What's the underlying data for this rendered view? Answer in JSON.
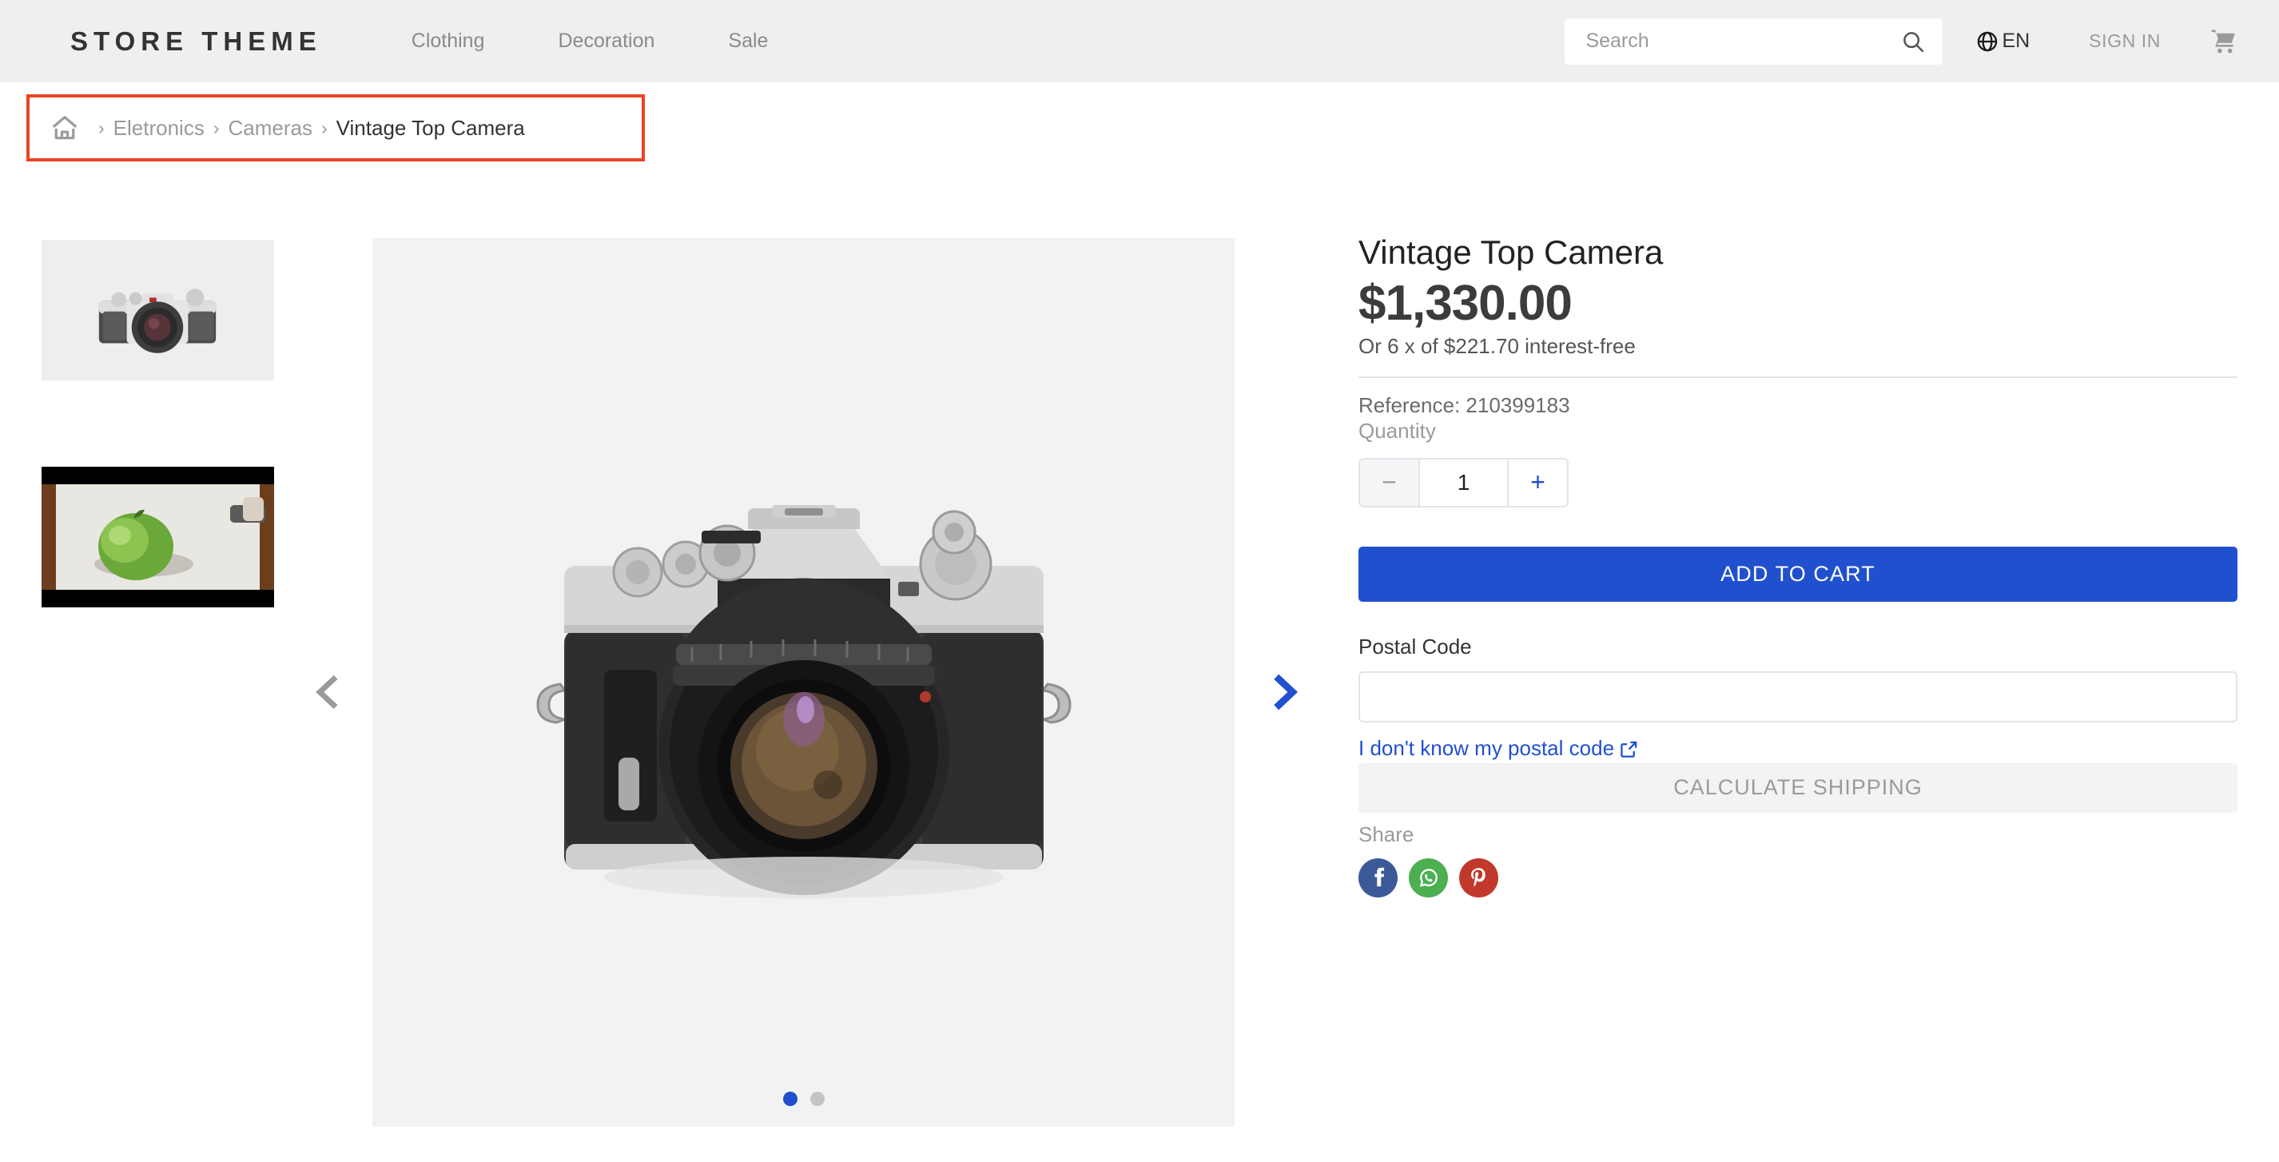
{
  "header": {
    "logo": "STORE THEME",
    "nav": [
      {
        "label": "Clothing"
      },
      {
        "label": "Decoration"
      },
      {
        "label": "Sale"
      }
    ],
    "search": {
      "placeholder": "Search",
      "value": "",
      "icon": "search-icon"
    },
    "language": {
      "label": "EN",
      "icon": "globe-icon"
    },
    "sign_in": "SIGN IN",
    "cart": {
      "icon": "cart-icon"
    },
    "background_color": "#efefef"
  },
  "breadcrumb": {
    "home_icon": "home-icon",
    "separator": "›",
    "items": [
      {
        "label": "Eletronics",
        "active": false
      },
      {
        "label": "Cameras",
        "active": false
      },
      {
        "label": "Vintage Top Camera",
        "active": true
      }
    ],
    "highlight_color": "#ea4325"
  },
  "gallery": {
    "thumbnails": [
      {
        "name": "vintage-slr-camera-front",
        "alt": "Silver and black vintage SLR camera on light gray background"
      },
      {
        "name": "green-apple-on-white-surface",
        "alt": "Green apple on a white surface with dark wood background"
      }
    ],
    "main_image": {
      "name": "vintage-slr-camera-front",
      "alt": "Silver and black vintage SLR camera centered on light gray background"
    },
    "prev_arrow": {
      "icon": "chevron-left-icon",
      "color": "#999999",
      "enabled": false
    },
    "next_arrow": {
      "icon": "chevron-right-icon",
      "color": "#2150cf",
      "enabled": true
    },
    "dots": [
      {
        "active": true
      },
      {
        "active": false
      }
    ],
    "active_index": 0,
    "background_color": "#f2f2f2"
  },
  "product": {
    "title": "Vintage Top Camera",
    "price": "$1,330.00",
    "installments": "Or 6 x of $221.70 interest-free",
    "reference": "Reference: 210399183",
    "quantity_label": "Quantity",
    "quantity": {
      "minus_label": "−",
      "value": "1",
      "plus_label": "+"
    },
    "add_to_cart": "ADD TO CART",
    "accent_color": "#2150cf"
  },
  "shipping": {
    "postal_label": "Postal Code",
    "postal_value": "",
    "postal_placeholder": "",
    "help_link": "I don't know my postal code",
    "help_link_icon": "external-link-icon",
    "calculate_button": "CALCULATE SHIPPING",
    "calculate_enabled": false
  },
  "share": {
    "label": "Share",
    "buttons": [
      {
        "name": "facebook",
        "color": "#3b5998"
      },
      {
        "name": "whatsapp",
        "color": "#4caf50"
      },
      {
        "name": "pinterest",
        "color": "#c0392b"
      }
    ]
  }
}
